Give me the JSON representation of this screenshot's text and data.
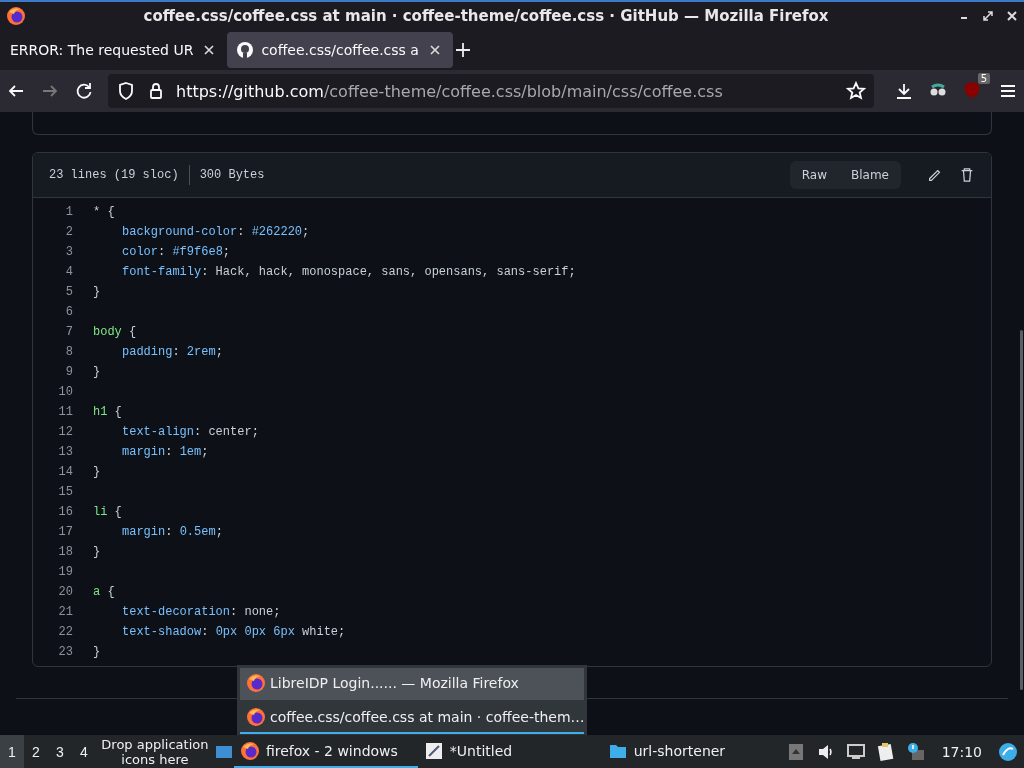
{
  "window": {
    "title": "coffee.css/coffee.css at main · coffee-theme/coffee.css · GitHub — Mozilla Firefox"
  },
  "tabs": [
    {
      "label": "ERROR: The requested UR",
      "selected": false
    },
    {
      "label": "coffee.css/coffee.css a",
      "selected": true
    }
  ],
  "address_bar": {
    "host": "https://github.com",
    "path": "/coffee-theme/coffee.css/blob/main/css/coffee.css",
    "extension_badge": "5"
  },
  "file_header": {
    "lines": "23 lines (19 sloc)",
    "size": "300 Bytes",
    "buttons": [
      "Raw",
      "Blame"
    ]
  },
  "code": [
    {
      "number": "1",
      "indented": false,
      "tokens": [
        {
          "text": "* {",
          "kind": "plain"
        }
      ]
    },
    {
      "number": "2",
      "indented": true,
      "tokens": [
        {
          "text": "background-color",
          "kind": "prop"
        },
        {
          "text": ": ",
          "kind": "plain"
        },
        {
          "text": "#262220",
          "kind": "num"
        },
        {
          "text": ";",
          "kind": "plain"
        }
      ]
    },
    {
      "number": "3",
      "indented": true,
      "tokens": [
        {
          "text": "color",
          "kind": "prop"
        },
        {
          "text": ": ",
          "kind": "plain"
        },
        {
          "text": "#f9f6e8",
          "kind": "num"
        },
        {
          "text": ";",
          "kind": "plain"
        }
      ]
    },
    {
      "number": "4",
      "indented": true,
      "tokens": [
        {
          "text": "font-family",
          "kind": "prop"
        },
        {
          "text": ": Hack, hack, monospace, sans, opensans, sans-serif;",
          "kind": "plain"
        }
      ]
    },
    {
      "number": "5",
      "indented": false,
      "tokens": [
        {
          "text": "}",
          "kind": "plain"
        }
      ]
    },
    {
      "number": "6"
    },
    {
      "number": "7",
      "indented": false,
      "tokens": [
        {
          "text": "body",
          "kind": "sel"
        },
        {
          "text": " {",
          "kind": "plain"
        }
      ]
    },
    {
      "number": "8",
      "indented": true,
      "tokens": [
        {
          "text": "padding",
          "kind": "prop"
        },
        {
          "text": ": ",
          "kind": "plain"
        },
        {
          "text": "2rem",
          "kind": "num"
        },
        {
          "text": ";",
          "kind": "plain"
        }
      ]
    },
    {
      "number": "9",
      "indented": false,
      "tokens": [
        {
          "text": "}",
          "kind": "plain"
        }
      ]
    },
    {
      "number": "10"
    },
    {
      "number": "11",
      "indented": false,
      "tokens": [
        {
          "text": "h1",
          "kind": "sel"
        },
        {
          "text": " {",
          "kind": "plain"
        }
      ]
    },
    {
      "number": "12",
      "indented": true,
      "tokens": [
        {
          "text": "text-align",
          "kind": "prop"
        },
        {
          "text": ": center;",
          "kind": "plain"
        }
      ]
    },
    {
      "number": "13",
      "indented": true,
      "tokens": [
        {
          "text": "margin",
          "kind": "prop"
        },
        {
          "text": ": ",
          "kind": "plain"
        },
        {
          "text": "1em",
          "kind": "num"
        },
        {
          "text": ";",
          "kind": "plain"
        }
      ]
    },
    {
      "number": "14",
      "indented": false,
      "tokens": [
        {
          "text": "}",
          "kind": "plain"
        }
      ]
    },
    {
      "number": "15"
    },
    {
      "number": "16",
      "indented": false,
      "tokens": [
        {
          "text": "li",
          "kind": "sel"
        },
        {
          "text": " {",
          "kind": "plain"
        }
      ]
    },
    {
      "number": "17",
      "indented": true,
      "tokens": [
        {
          "text": "margin",
          "kind": "prop"
        },
        {
          "text": ": ",
          "kind": "plain"
        },
        {
          "text": "0.5em",
          "kind": "num"
        },
        {
          "text": ";",
          "kind": "plain"
        }
      ]
    },
    {
      "number": "18",
      "indented": false,
      "tokens": [
        {
          "text": "}",
          "kind": "plain"
        }
      ]
    },
    {
      "number": "19"
    },
    {
      "number": "20",
      "indented": false,
      "tokens": [
        {
          "text": "a",
          "kind": "sel"
        },
        {
          "text": " {",
          "kind": "plain"
        }
      ]
    },
    {
      "number": "21",
      "indented": true,
      "tokens": [
        {
          "text": "text-decoration",
          "kind": "prop"
        },
        {
          "text": ": none;",
          "kind": "plain"
        }
      ]
    },
    {
      "number": "22",
      "indented": true,
      "tokens": [
        {
          "text": "text-shadow",
          "kind": "prop"
        },
        {
          "text": ": ",
          "kind": "plain"
        },
        {
          "text": "0px 0px 6px",
          "kind": "num"
        },
        {
          "text": " white;",
          "kind": "plain"
        }
      ]
    },
    {
      "number": "23",
      "indented": false,
      "tokens": [
        {
          "text": "}",
          "kind": "plain"
        }
      ]
    }
  ],
  "window_list_popup": [
    {
      "label": "LibreIDP Login...... — Mozilla Firefox",
      "selected": true
    },
    {
      "label": "coffee.css/coffee.css at main · coffee-them…",
      "selected": false
    }
  ],
  "taskbar": {
    "workspaces": [
      {
        "label": "1",
        "selected": true
      },
      {
        "label": "2",
        "selected": false
      },
      {
        "label": "3",
        "selected": false
      },
      {
        "label": "4",
        "selected": false
      }
    ],
    "launcher_hint": "Drop application icons here",
    "tasks": [
      {
        "label": "firefox - 2 windows",
        "kind": "firefox",
        "selected": true
      },
      {
        "label": "*Untitled",
        "kind": "editor",
        "selected": false
      },
      {
        "label": "url-shortener",
        "kind": "folder",
        "selected": false
      }
    ],
    "clock": "17:10"
  }
}
